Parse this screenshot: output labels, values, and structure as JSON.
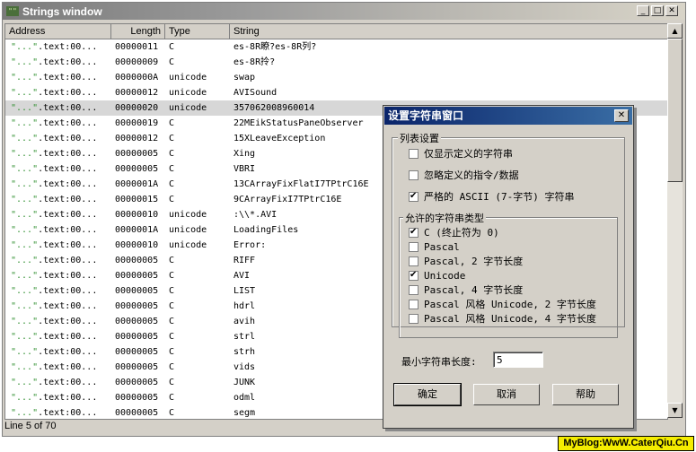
{
  "window": {
    "title": "Strings window",
    "icon": "strings-window-icon"
  },
  "columns": {
    "address": "Address",
    "length": "Length",
    "type": "Type",
    "string": "String"
  },
  "rows": [
    {
      "q": "\"...\"",
      "addr": ".text:00...",
      "len": "00000011",
      "type": "C",
      "str": "es-8R瞭?es-8R列?"
    },
    {
      "q": "\"...\"",
      "addr": ".text:00...",
      "len": "00000009",
      "type": "C",
      "str": "es-8R拎?"
    },
    {
      "q": "\"...\"",
      "addr": ".text:00...",
      "len": "0000000A",
      "type": "unicode",
      "str": "swap"
    },
    {
      "q": "\"...\"",
      "addr": ".text:00...",
      "len": "00000012",
      "type": "unicode",
      "str": "AVISound"
    },
    {
      "q": "\"...\"",
      "addr": ".text:00...",
      "len": "00000020",
      "type": "unicode",
      "str": "357062008960014",
      "selected": true
    },
    {
      "q": "\"...\"",
      "addr": ".text:00...",
      "len": "00000019",
      "type": "C",
      "str": "22MEikStatusPaneObserver"
    },
    {
      "q": "\"...\"",
      "addr": ".text:00...",
      "len": "00000012",
      "type": "C",
      "str": "15XLeaveException"
    },
    {
      "q": "\"...\"",
      "addr": ".text:00...",
      "len": "00000005",
      "type": "C",
      "str": "Xing"
    },
    {
      "q": "\"...\"",
      "addr": ".text:00...",
      "len": "00000005",
      "type": "C",
      "str": "VBRI"
    },
    {
      "q": "\"...\"",
      "addr": ".text:00...",
      "len": "0000001A",
      "type": "C",
      "str": "13CArrayFixFlatI7TPtrC16E"
    },
    {
      "q": "\"...\"",
      "addr": ".text:00...",
      "len": "00000015",
      "type": "C",
      "str": "9CArrayFixI7TPtrC16E"
    },
    {
      "q": "\"...\"",
      "addr": ".text:00...",
      "len": "00000010",
      "type": "unicode",
      "str": ":\\\\*.AVI"
    },
    {
      "q": "\"...\"",
      "addr": ".text:00...",
      "len": "0000001A",
      "type": "unicode",
      "str": "LoadingFiles"
    },
    {
      "q": "\"...\"",
      "addr": ".text:00...",
      "len": "00000010",
      "type": "unicode",
      "str": "Error:"
    },
    {
      "q": "\"...\"",
      "addr": ".text:00...",
      "len": "00000005",
      "type": "C",
      "str": "RIFF"
    },
    {
      "q": "\"...\"",
      "addr": ".text:00...",
      "len": "00000005",
      "type": "C",
      "str": "AVI"
    },
    {
      "q": "\"...\"",
      "addr": ".text:00...",
      "len": "00000005",
      "type": "C",
      "str": "LIST"
    },
    {
      "q": "\"...\"",
      "addr": ".text:00...",
      "len": "00000005",
      "type": "C",
      "str": "hdrl"
    },
    {
      "q": "\"...\"",
      "addr": ".text:00...",
      "len": "00000005",
      "type": "C",
      "str": "avih"
    },
    {
      "q": "\"...\"",
      "addr": ".text:00...",
      "len": "00000005",
      "type": "C",
      "str": "strl"
    },
    {
      "q": "\"...\"",
      "addr": ".text:00...",
      "len": "00000005",
      "type": "C",
      "str": "strh"
    },
    {
      "q": "\"...\"",
      "addr": ".text:00...",
      "len": "00000005",
      "type": "C",
      "str": "vids"
    },
    {
      "q": "\"...\"",
      "addr": ".text:00...",
      "len": "00000005",
      "type": "C",
      "str": "JUNK"
    },
    {
      "q": "\"...\"",
      "addr": ".text:00...",
      "len": "00000005",
      "type": "C",
      "str": "odml"
    },
    {
      "q": "\"...\"",
      "addr": ".text:00...",
      "len": "00000005",
      "type": "C",
      "str": "segm"
    }
  ],
  "status": "Line 5 of 70",
  "dialog": {
    "title": "设置字符串窗口",
    "list_group": "列表设置",
    "list_options": [
      {
        "label": "仅显示定义的字符串",
        "checked": false
      },
      {
        "label": "忽略定义的指令/数据",
        "checked": false
      },
      {
        "label": "严格的 ASCII (7-字节) 字符串",
        "checked": true
      }
    ],
    "types_group": "允许的字符串类型",
    "types": [
      {
        "label": "C (终止符为 0)",
        "checked": true
      },
      {
        "label": "Pascal",
        "checked": false
      },
      {
        "label": "Pascal, 2 字节长度",
        "checked": false
      },
      {
        "label": "Unicode",
        "checked": true
      },
      {
        "label": "Pascal, 4 字节长度",
        "checked": false
      },
      {
        "label": "Pascal 风格 Unicode, 2 字节长度",
        "checked": false
      },
      {
        "label": "Pascal 风格 Unicode, 4 字节长度",
        "checked": false
      }
    ],
    "min_length_label": "最小字符串长度:",
    "min_length_value": "5",
    "ok": "确定",
    "cancel": "取消",
    "help": "帮助"
  },
  "watermark": "MyBlog:WwW.CaterQiu.Cn"
}
